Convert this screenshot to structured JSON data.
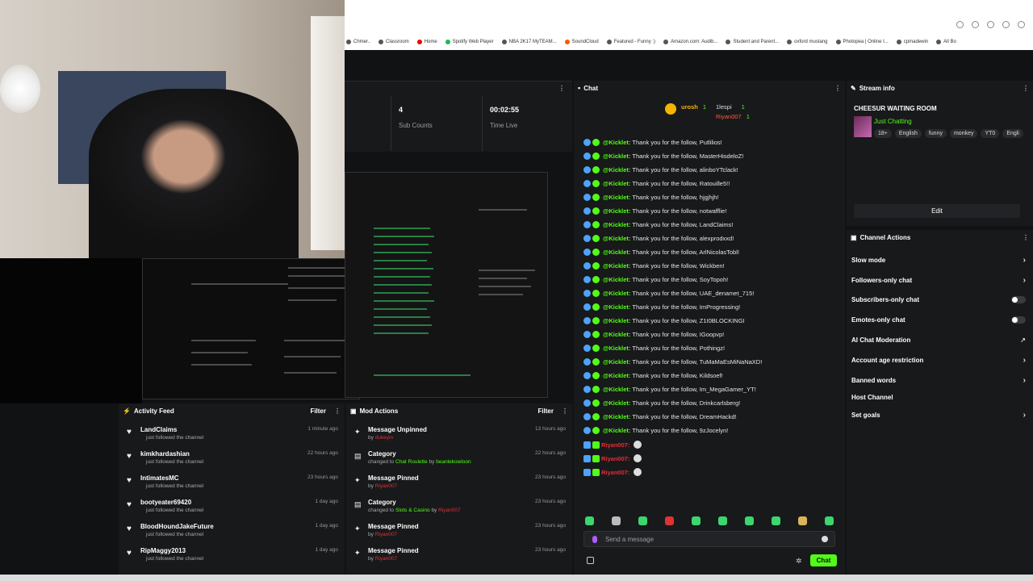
{
  "bookmarks": [
    "Chmer..",
    "Classroom",
    "Home",
    "Spotify Web Player",
    "NBA 2K17 MyTEAM...",
    "SoundCloud",
    "Featured - Funny :)",
    "Amazon.com: Audib...",
    "Student and Parent...",
    "oxford mustang",
    "Photopea | Online I...",
    "cpmadewin",
    "All Bo"
  ],
  "stats": {
    "sub_counts_value": "4",
    "sub_counts_label": "Sub Counts",
    "time_live_value": "00:02:55",
    "time_live_label": "Time Live"
  },
  "chat": {
    "title": "Chat",
    "leaderboard": [
      {
        "name": "urosh",
        "count": "1"
      },
      {
        "name": "1lespi",
        "count": "1"
      },
      {
        "name": "Riyan007",
        "count": "1"
      }
    ],
    "bot_name": "@Kicklet:",
    "messages": [
      "Thank you for the follow, Putlilios!",
      "Thank you for the follow, MasterHisdeloZ!",
      "Thank you for the follow, alinboYTclack!",
      "Thank you for the follow, Ratouille5!!",
      "Thank you for the follow, hjgjhjh!",
      "Thank you for the follow, notwafflie!",
      "Thank you for the follow, LandClaims!",
      "Thank you for the follow, alexprodxxd!",
      "Thank you for the follow, ArlNicolasTobl!",
      "Thank you for the follow, Wickben!",
      "Thank you for the follow, SoyTopoh!",
      "Thank you for the follow, UAE_denamet_715!",
      "Thank you for the follow, ImProgressing!",
      "Thank you for the follow, Z1I0BLOCKINGI",
      "Thank you for the follow, IGoopvp!",
      "Thank you for the follow, Pothingz!",
      "Thank you for the follow, TuMaMaEsMiNaNaXD!",
      "Thank you for the follow, Kildsoef!",
      "Thank you for the follow, Im_MegaGamer_YT!",
      "Thank you for the follow, Drinkcarlsberg!",
      "Thank you for the follow, DreamHackd!",
      "Thank you for the follow, 9zJocelyn!"
    ],
    "red_user": "Riyan007:",
    "input_placeholder": "Send a message",
    "send_label": "Chat"
  },
  "stream_info": {
    "title": "Stream info",
    "stream_title": "CHEESUR WAITING ROOM",
    "category": "Just Chatting",
    "tags": [
      "18+",
      "English",
      "funny",
      "monkey",
      "YT0",
      "Engli"
    ],
    "edit_label": "Edit"
  },
  "channel_actions": {
    "title": "Channel Actions",
    "items": [
      "Slow mode",
      "Followers-only chat",
      "Subscribers-only chat",
      "Emotes-only chat",
      "AI Chat Moderation",
      "Account age restriction",
      "Banned words",
      "Host Channel",
      "Set goals"
    ]
  },
  "activity_feed": {
    "title": "Activity Feed",
    "filter_label": "Filter",
    "items": [
      {
        "name": "LandClaims",
        "sub": "just followed the channel",
        "time": "1 minute ago"
      },
      {
        "name": "kimkhardashian",
        "sub": "just followed the channel",
        "time": "22 hours ago"
      },
      {
        "name": "IntimatesMC",
        "sub": "just followed the channel",
        "time": "23 hours ago"
      },
      {
        "name": "bootyeater69420",
        "sub": "just followed the channel",
        "time": "1 day ago"
      },
      {
        "name": "BloodHoundJakeFuture",
        "sub": "just followed the channel",
        "time": "1 day ago"
      },
      {
        "name": "RipMaggy2013",
        "sub": "just followed the channel",
        "time": "1 day ago"
      }
    ]
  },
  "mod_actions": {
    "title": "Mod Actions",
    "filter_label": "Filter",
    "items": [
      {
        "name": "Message Unpinned",
        "by": "by",
        "user": "dukeyin",
        "time": "13 hours ago"
      },
      {
        "name": "Category",
        "by": "changed to",
        "target": "Chat Roulette",
        "by2": "by",
        "user": "beanlekowloon",
        "time": "22 hours ago"
      },
      {
        "name": "Message Pinned",
        "by": "by",
        "user": "Riyan007",
        "time": "23 hours ago"
      },
      {
        "name": "Category",
        "by": "changed to",
        "target": "Slots & Casino",
        "by2": "by",
        "user": "Riyan007",
        "time": "23 hours ago"
      },
      {
        "name": "Message Pinned",
        "by": "by",
        "user": "Riyan007",
        "time": "23 hours ago"
      },
      {
        "name": "Message Pinned",
        "by": "by",
        "user": "Riyan007",
        "time": "23 hours ago"
      }
    ]
  },
  "colors": {
    "accent": "#53fc18",
    "panel": "#18191b",
    "background": "#111214",
    "red": "#e0303a"
  }
}
